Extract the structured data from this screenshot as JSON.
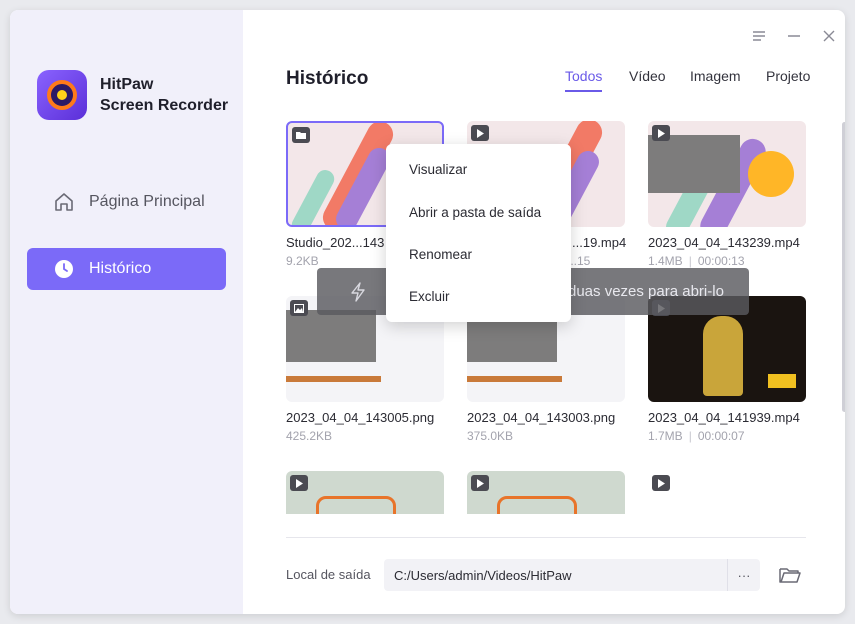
{
  "app": {
    "name_line1": "HitPaw",
    "name_line2": "Screen Recorder"
  },
  "sidebar": {
    "items": [
      {
        "label": "Página Principal",
        "icon": "home-icon",
        "active": false
      },
      {
        "label": "Histórico",
        "icon": "clock-icon",
        "active": true
      }
    ]
  },
  "header": {
    "title": "Histórico",
    "tabs": [
      {
        "label": "Todos",
        "active": true
      },
      {
        "label": "Vídeo",
        "active": false
      },
      {
        "label": "Imagem",
        "active": false
      },
      {
        "label": "Projeto",
        "active": false
      }
    ]
  },
  "files": [
    {
      "name": "Studio_202...143",
      "size": "9.2KB",
      "duration": "",
      "type": "folder",
      "selected": true
    },
    {
      "name": "...19.mp4",
      "size": "",
      "duration": "...15",
      "type": "video",
      "selected": false
    },
    {
      "name": "2023_04_04_143239.mp4",
      "size": "1.4MB",
      "duration": "00:00:13",
      "type": "video",
      "selected": false
    },
    {
      "name": "2023_04_04_143005.png",
      "size": "425.2KB",
      "duration": "",
      "type": "image",
      "selected": false
    },
    {
      "name": "2023_04_04_143003.png",
      "size": "375.0KB",
      "duration": "",
      "type": "image",
      "selected": false
    },
    {
      "name": "2023_04_04_141939.mp4",
      "size": "1.7MB",
      "duration": "00:00:07",
      "type": "video",
      "selected": false
    },
    {
      "name": "",
      "size": "",
      "duration": "",
      "type": "video",
      "selected": false
    },
    {
      "name": "",
      "size": "",
      "duration": "",
      "type": "video",
      "selected": false
    },
    {
      "name": "",
      "size": "",
      "duration": "",
      "type": "video",
      "selected": false
    }
  ],
  "context_menu": {
    "items": [
      "Visualizar",
      "Abrir a pasta de saída",
      "Renomear",
      "Excluir"
    ]
  },
  "hint": {
    "text": "duas vezes para abri-lo"
  },
  "output": {
    "label": "Local de saída",
    "path": "C:/Users/admin/Videos/HitPaw",
    "more": "···"
  },
  "colors": {
    "accent": "#7b6af8",
    "sidebar_bg": "#f1f0fa"
  }
}
